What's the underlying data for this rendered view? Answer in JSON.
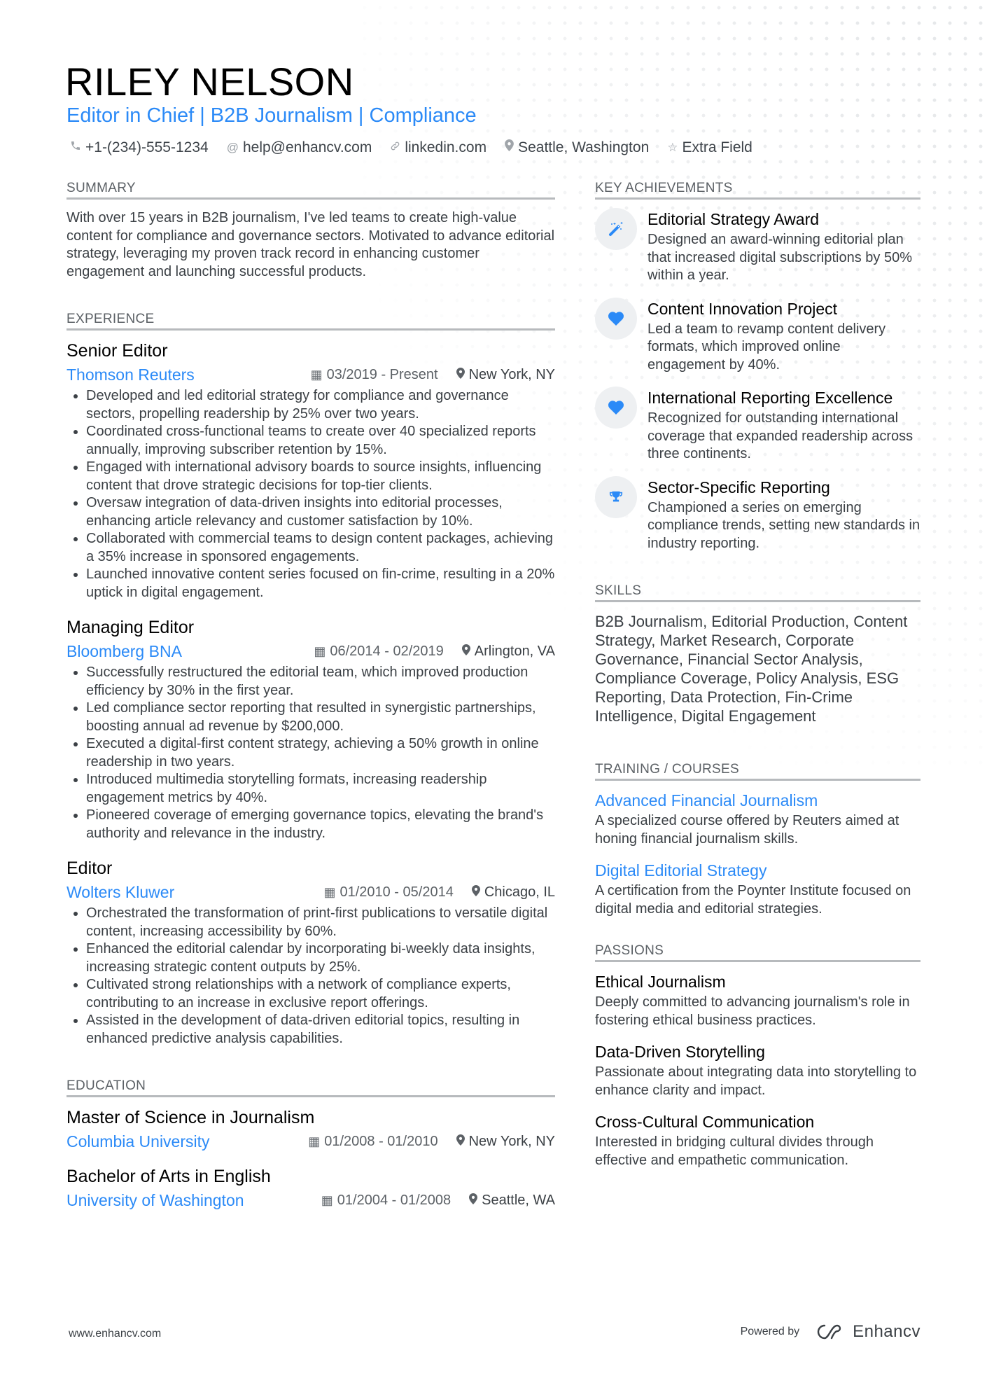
{
  "header": {
    "name": "RILEY NELSON",
    "headline": "Editor in Chief | B2B Journalism | Compliance",
    "contacts": [
      {
        "icon": "phone-icon",
        "glyph": "✆",
        "text": "+1-(234)-555-1234"
      },
      {
        "icon": "at-icon",
        "glyph": "@",
        "text": "help@enhancv.com"
      },
      {
        "icon": "link-icon",
        "glyph": "🔗",
        "text": "linkedin.com"
      },
      {
        "icon": "location-pin-icon",
        "glyph": "⚲",
        "text": "Seattle, Washington"
      },
      {
        "icon": "star-icon",
        "glyph": "☆",
        "text": "Extra Field"
      }
    ]
  },
  "colors": {
    "accent": "#2b8af7",
    "text": "#3b4045",
    "heading": "#000000",
    "rule": "#b7babd"
  },
  "summary": {
    "title": "SUMMARY",
    "text": "With over 15 years in B2B journalism, I've led teams to create high-value content for compliance and governance sectors. Motivated to advance editorial strategy, leveraging my proven track record in enhancing customer engagement and launching successful products."
  },
  "experience": {
    "title": "EXPERIENCE",
    "jobs": [
      {
        "role": "Senior Editor",
        "company": "Thomson Reuters",
        "dates": "03/2019 - Present",
        "location": "New York, NY",
        "bullets": [
          "Developed and led editorial strategy for compliance and governance sectors, propelling readership by 25% over two years.",
          "Coordinated cross-functional teams to create over 40 specialized reports annually, improving subscriber retention by 15%.",
          "Engaged with international advisory boards to source insights, influencing content that drove strategic decisions for top-tier clients.",
          "Oversaw integration of data-driven insights into editorial processes, enhancing article relevancy and customer satisfaction by 10%.",
          "Collaborated with commercial teams to design content packages, achieving a 35% increase in sponsored engagements.",
          "Launched innovative content series focused on fin-crime, resulting in a 20% uptick in digital engagement."
        ]
      },
      {
        "role": "Managing Editor",
        "company": "Bloomberg BNA",
        "dates": "06/2014 - 02/2019",
        "location": "Arlington, VA",
        "bullets": [
          "Successfully restructured the editorial team, which improved production efficiency by 30% in the first year.",
          "Led compliance sector reporting that resulted in synergistic partnerships, boosting annual ad revenue by $200,000.",
          "Executed a digital-first content strategy, achieving a 50% growth in online readership in two years.",
          "Introduced multimedia storytelling formats, increasing readership engagement metrics by 40%.",
          "Pioneered coverage of emerging governance topics, elevating the brand's authority and relevance in the industry."
        ]
      },
      {
        "role": "Editor",
        "company": "Wolters Kluwer",
        "dates": "01/2010 - 05/2014",
        "location": "Chicago, IL",
        "bullets": [
          "Orchestrated the transformation of print-first publications to versatile digital content, increasing accessibility by 60%.",
          "Enhanced the editorial calendar by incorporating bi-weekly data insights, increasing strategic content outputs by 25%.",
          "Cultivated strong relationships with a network of compliance experts, contributing to an increase in exclusive report offerings.",
          "Assisted in the development of data-driven editorial topics, resulting in enhanced predictive analysis capabilities."
        ]
      }
    ]
  },
  "education": {
    "title": "EDUCATION",
    "items": [
      {
        "degree": "Master of Science in Journalism",
        "school": "Columbia University",
        "dates": "01/2008 - 01/2010",
        "location": "New York, NY"
      },
      {
        "degree": "Bachelor of Arts in English",
        "school": "University of Washington",
        "dates": "01/2004 - 01/2008",
        "location": "Seattle, WA"
      }
    ]
  },
  "achievements": {
    "title": "KEY ACHIEVEMENTS",
    "items": [
      {
        "icon": "magic-wand-icon",
        "title": "Editorial Strategy Award",
        "desc": "Designed an award-winning editorial plan that increased digital subscriptions by 50% within a year."
      },
      {
        "icon": "heart-icon",
        "title": "Content Innovation Project",
        "desc": "Led a team to revamp content delivery formats, which improved online engagement by 40%."
      },
      {
        "icon": "heart-icon",
        "title": "International Reporting Excellence",
        "desc": "Recognized for outstanding international coverage that expanded readership across three continents."
      },
      {
        "icon": "trophy-icon",
        "title": "Sector-Specific Reporting",
        "desc": "Championed a series on emerging compliance trends, setting new standards in industry reporting."
      }
    ]
  },
  "skills": {
    "title": "SKILLS",
    "text": "B2B Journalism, Editorial Production, Content Strategy, Market Research, Corporate Governance, Financial Sector Analysis, Compliance Coverage, Policy Analysis, ESG Reporting, Data Protection, Fin-Crime Intelligence, Digital Engagement"
  },
  "training": {
    "title": "TRAINING / COURSES",
    "items": [
      {
        "title": "Advanced Financial Journalism",
        "desc": "A specialized course offered by Reuters aimed at honing financial journalism skills."
      },
      {
        "title": "Digital Editorial Strategy",
        "desc": "A certification from the Poynter Institute focused on digital media and editorial strategies."
      }
    ]
  },
  "passions": {
    "title": "PASSIONS",
    "items": [
      {
        "title": "Ethical Journalism",
        "desc": "Deeply committed to advancing journalism's role in fostering ethical business practices."
      },
      {
        "title": "Data-Driven Storytelling",
        "desc": "Passionate about integrating data into storytelling to enhance clarity and impact."
      },
      {
        "title": "Cross-Cultural Communication",
        "desc": "Interested in bridging cultural divides through effective and empathetic communication."
      }
    ]
  },
  "footer": {
    "website": "www.enhancv.com",
    "powered_by": "Powered by",
    "brand": "Enhancv"
  }
}
